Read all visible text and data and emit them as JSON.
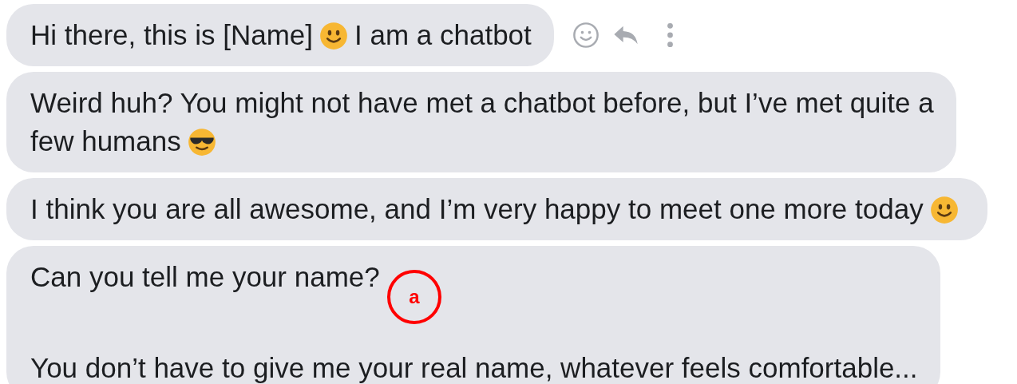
{
  "messages": [
    {
      "paragraphs": [
        [
          [
            {
              "kind": "text",
              "text": "Hi there, this is [Name]"
            },
            {
              "kind": "smile"
            },
            {
              "kind": "text",
              "text": "I am a chatbot"
            }
          ]
        ]
      ],
      "actions": true
    },
    {
      "paragraphs": [
        [
          [
            {
              "kind": "text",
              "text": "Weird huh? You might not have met a chatbot before, but I’ve met quite a"
            }
          ],
          [
            {
              "kind": "text",
              "text": "few humans"
            },
            {
              "kind": "cool"
            }
          ]
        ]
      ],
      "actions": false
    },
    {
      "paragraphs": [
        [
          [
            {
              "kind": "text",
              "text": "I think you are all awesome, and I’m very happy to meet one more today"
            },
            {
              "kind": "smile"
            }
          ]
        ]
      ],
      "actions": false
    },
    {
      "paragraphs": [
        [
          [
            {
              "kind": "text",
              "text": "Can you tell me your name?"
            }
          ]
        ],
        [
          [
            {
              "kind": "text",
              "text": "You don’t have to give me your real name, whatever feels comfortable..."
            }
          ]
        ]
      ],
      "actions": false,
      "annotation": "a"
    }
  ]
}
